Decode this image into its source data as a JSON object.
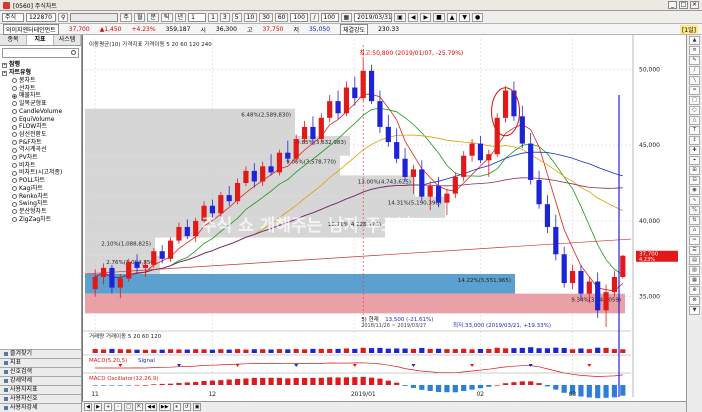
{
  "window": {
    "title": "[0560] 주식차트",
    "buttons": [
      "_",
      "□",
      "×"
    ]
  },
  "toolbar": {
    "market": "주식",
    "code": "122870",
    "periods": [
      "주",
      "월",
      "분",
      "틱",
      "년"
    ],
    "period_input": "1",
    "minute_buttons": [
      "1",
      "3",
      "5",
      "10",
      "30",
      "60"
    ],
    "count1": "100",
    "count2": "100",
    "date": "2019/03/31"
  },
  "infobar": {
    "name": "와이지엔터테인먼트",
    "price": "37,700",
    "change": "▲1,450",
    "pct": "+4.23%",
    "volume": "359,187",
    "open_label": "시",
    "open": "36,300",
    "high_label": "고",
    "high": "37,750",
    "low_label": "저",
    "low": "35,050",
    "strength_label": "체결강도",
    "strength": "230.33",
    "right_label": "[1일]"
  },
  "left_panel": {
    "tabs": [
      "종목",
      "지표",
      "사스템"
    ],
    "groups": [
      {
        "label": "참행",
        "expanded": true
      },
      {
        "label": "자트유형",
        "expanded": true
      }
    ],
    "items": [
      {
        "label": "봉차트",
        "selected": false
      },
      {
        "label": "선차트",
        "selected": false
      },
      {
        "label": "매물차트",
        "selected": true
      },
      {
        "label": "일목균형표",
        "selected": false
      },
      {
        "label": "CandleVolume",
        "selected": false
      },
      {
        "label": "EquiVolume",
        "selected": false
      },
      {
        "label": "FLOW차트",
        "selected": false
      },
      {
        "label": "삼선전환도",
        "selected": false
      },
      {
        "label": "P&F차트",
        "selected": false
      },
      {
        "label": "역시계곡선",
        "selected": false
      },
      {
        "label": "PV차트",
        "selected": false
      },
      {
        "label": "비차트",
        "selected": false
      },
      {
        "label": "비차트(시고저종)",
        "selected": false
      },
      {
        "label": "POLL차트",
        "selected": false
      },
      {
        "label": "Kagi차트",
        "selected": false
      },
      {
        "label": "Renko차트",
        "selected": false
      },
      {
        "label": "Swing차트",
        "selected": false
      },
      {
        "label": "분산형차트",
        "selected": false
      },
      {
        "label": "ZigZag차트",
        "selected": false
      }
    ],
    "bottom_bars": [
      "즐겨찾기",
      "지표",
      "신호검색",
      "강세약세",
      "사용자지표",
      "사용자신호",
      "사용자강세"
    ]
  },
  "chart": {
    "price_axis": [
      "50,000",
      "45,000",
      "40,000",
      "35,000"
    ],
    "price_current": "37,700",
    "price_current_pct": "4.23%",
    "date_axis": [
      "11",
      "12",
      "2019/01",
      "02",
      "03"
    ],
    "legend_main": [
      "이동평균(10)",
      "가격지표",
      "가격이동",
      "5",
      "20",
      "60",
      "120",
      "240"
    ],
    "legend_volume": [
      "거래량",
      "거래이동",
      "5",
      "20",
      "60",
      "120"
    ],
    "legend_macd_volume": "MACD(5,20,5)",
    "legend_macd_volume_sig": "Signal",
    "legend_macd_osc": "MACD Oscillator(12,26,9)",
    "annotation_high": "최고:50,800 (2019/01/07, -25.79%)",
    "annotation_low": "최저:33,000 (2019/03/21, +19.33%)",
    "annotation_mid": "5) 현재",
    "annotation_mid_val": "13,500 (-21.61%)",
    "annotation_range": "2018/11/26 ~ 2019/03/27",
    "watermark": "주식 쇼 개해주는 남자 주소남",
    "volume_profile": [
      {
        "label": "6.48%(2,589,830)"
      },
      {
        "label": "9.85%(3,632,983)"
      },
      {
        "label": "9.06%(3,578,770)"
      },
      {
        "label": "13.00%(4,743,625)"
      },
      {
        "label": "14.31%(5,190,390)"
      },
      {
        "label": "10.71%(4,226,173)"
      },
      {
        "label": "2.10%(1,088,825)"
      },
      {
        "label": "2.76%(1,094,850)"
      },
      {
        "label": "14.22%(5,551,965)"
      },
      {
        "label": "9.34%(3,445,059)"
      }
    ]
  },
  "chart_data": {
    "type": "candlestick",
    "ylim": [
      33000,
      52000
    ],
    "candles": [
      [
        35500,
        36800,
        35000,
        36300
      ],
      [
        36300,
        37200,
        35800,
        36900
      ],
      [
        36900,
        37100,
        35200,
        35600
      ],
      [
        35600,
        36500,
        34900,
        36200
      ],
      [
        36200,
        37500,
        36000,
        37300
      ],
      [
        37300,
        37800,
        36600,
        36900
      ],
      [
        36900,
        37400,
        36300,
        37100
      ],
      [
        37100,
        38200,
        36900,
        38000
      ],
      [
        38000,
        38400,
        37200,
        37500
      ],
      [
        37500,
        38900,
        37300,
        38700
      ],
      [
        38700,
        39900,
        38500,
        39600
      ],
      [
        39600,
        40100,
        38800,
        39000
      ],
      [
        39000,
        40200,
        38600,
        40000
      ],
      [
        40000,
        41300,
        39800,
        41000
      ],
      [
        41000,
        41400,
        40200,
        40500
      ],
      [
        40500,
        41900,
        40300,
        41700
      ],
      [
        41700,
        42300,
        41000,
        41300
      ],
      [
        41300,
        42800,
        41100,
        42500
      ],
      [
        42500,
        43600,
        42300,
        43300
      ],
      [
        43300,
        43800,
        42200,
        42600
      ],
      [
        42600,
        43900,
        42300,
        43600
      ],
      [
        43600,
        44400,
        43000,
        43200
      ],
      [
        43200,
        44700,
        43000,
        44500
      ],
      [
        44500,
        45300,
        43800,
        44100
      ],
      [
        44100,
        45700,
        43900,
        45400
      ],
      [
        45400,
        46600,
        45100,
        46200
      ],
      [
        46200,
        46900,
        45000,
        45400
      ],
      [
        45400,
        47100,
        45200,
        46800
      ],
      [
        46800,
        48300,
        46500,
        47900
      ],
      [
        47900,
        48600,
        46700,
        47100
      ],
      [
        47100,
        49200,
        46900,
        48800
      ],
      [
        48800,
        49500,
        47600,
        48100
      ],
      [
        48100,
        50800,
        47900,
        49900
      ],
      [
        49900,
        50300,
        47700,
        47900
      ],
      [
        47900,
        48600,
        45800,
        46200
      ],
      [
        46200,
        47000,
        44900,
        45200
      ],
      [
        45200,
        46100,
        43800,
        44100
      ],
      [
        44100,
        44800,
        42600,
        42900
      ],
      [
        42900,
        43700,
        41800,
        43400
      ],
      [
        43400,
        44000,
        41300,
        41600
      ],
      [
        41600,
        42600,
        40700,
        42300
      ],
      [
        42300,
        42900,
        40900,
        41200
      ],
      [
        41200,
        42100,
        40400,
        41800
      ],
      [
        41800,
        43200,
        41500,
        42900
      ],
      [
        42900,
        44600,
        42600,
        44300
      ],
      [
        44300,
        45400,
        43900,
        45100
      ],
      [
        45100,
        45600,
        43800,
        44000
      ],
      [
        44000,
        44700,
        42900,
        44400
      ],
      [
        44400,
        47100,
        44200,
        46800
      ],
      [
        46800,
        48900,
        46500,
        48600
      ],
      [
        48600,
        49200,
        46600,
        46900
      ],
      [
        46900,
        47600,
        44800,
        45100
      ],
      [
        45100,
        45800,
        42400,
        42700
      ],
      [
        42700,
        43300,
        40800,
        41100
      ],
      [
        41100,
        41700,
        39200,
        39600
      ],
      [
        39600,
        40400,
        37400,
        37800
      ],
      [
        37800,
        38300,
        35600,
        35900
      ],
      [
        35900,
        37100,
        35500,
        36700
      ],
      [
        36700,
        37100,
        34800,
        35200
      ],
      [
        35200,
        36300,
        34600,
        36000
      ],
      [
        36000,
        36600,
        33600,
        34100
      ],
      [
        34100,
        35800,
        33000,
        35300
      ],
      [
        35300,
        36700,
        35000,
        36300
      ],
      [
        36300,
        37750,
        36200,
        37700
      ]
    ]
  },
  "right_toolbar": [
    "▲",
    "≡",
    "✎",
    "/",
    "╲",
    "═",
    "□",
    "○",
    "△",
    "T",
    "↕",
    "✚",
    "⌖",
    "⊞",
    "⊟",
    "◉",
    "∿",
    "%",
    "⇅",
    "⌂",
    "✂",
    "☰",
    "▤",
    "▥",
    "▦",
    "⊕",
    "⊗",
    "▼"
  ],
  "bottom_toolbar": [
    "◀",
    "▶",
    "+",
    "-",
    "□",
    "⇱",
    "◀◀",
    "▶▶",
    "⏸",
    "↺",
    "▣"
  ]
}
